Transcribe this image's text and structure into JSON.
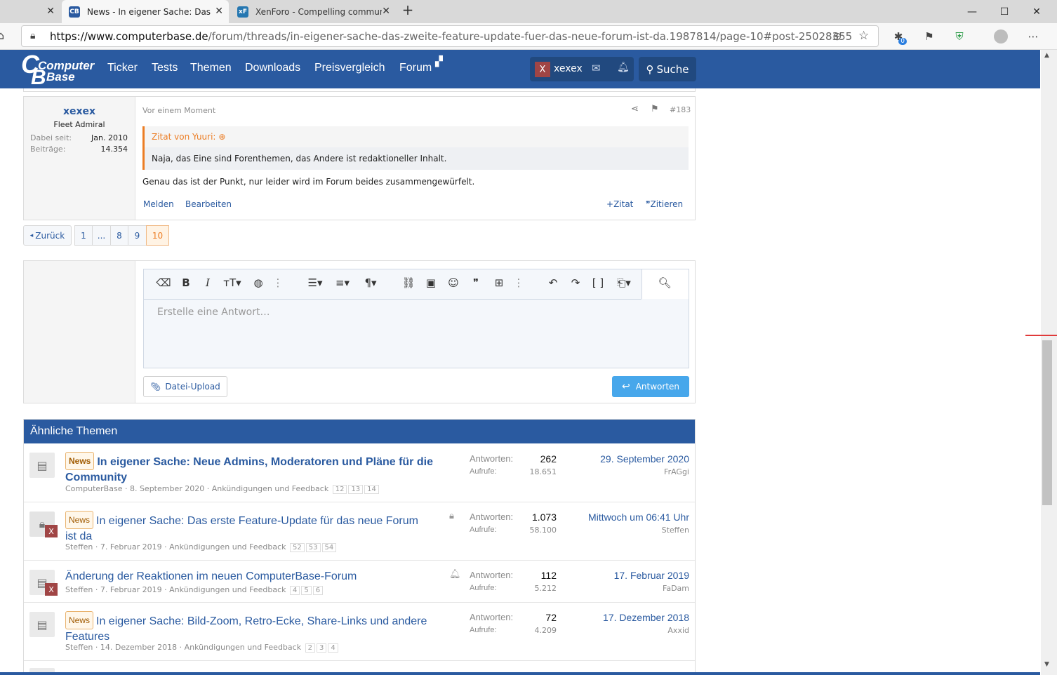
{
  "browser": {
    "tabs": [
      {
        "label": ""
      },
      {
        "label": "News - In eigener Sache: Das zw",
        "favicon": "CB"
      },
      {
        "label": "XenForo - Compelling communi",
        "favicon": "xF"
      }
    ],
    "url_domain": "https://www.computerbase.de",
    "url_path": "/forum/threads/in-eigener-sache-das-zweite-feature-update-fuer-das-neue-forum-ist-da.1987814/page-10#post-25028355",
    "extension_badge": "0"
  },
  "site": {
    "logo_line1": "Computer",
    "logo_line2": "Base",
    "nav": [
      "Ticker",
      "Tests",
      "Themen",
      "Downloads",
      "Preisvergleich",
      "Forum"
    ],
    "user_initial": "X",
    "username": "xexex",
    "search_label": "Suche"
  },
  "post": {
    "author": "xexex",
    "rank": "Fleet Admiral",
    "joined_label": "Dabei seit:",
    "joined_value": "Jan. 2010",
    "posts_label": "Beiträge:",
    "posts_value": "14.354",
    "time": "Vor einem Moment",
    "number": "#183",
    "quote_header": "Zitat von Yuuri:",
    "quote_text": "Naja, das Eine sind Forenthemen, das Andere ist redaktioneller Inhalt.",
    "body": "Genau das ist der Punkt, nur leider wird im Forum beides zusammengewürfelt.",
    "actions": {
      "report": "Melden",
      "edit": "Bearbeiten",
      "addquote": "Zitat",
      "quote": "Zitieren"
    }
  },
  "pagination": {
    "back": "Zurück",
    "pages": [
      "1",
      "...",
      "8",
      "9",
      "10"
    ],
    "current": "10"
  },
  "editor": {
    "placeholder": "Erstelle eine Antwort…",
    "upload": "Datei-Upload",
    "reply": "Antworten"
  },
  "similar": {
    "heading": "Ähnliche Themen",
    "stat_replies": "Antworten:",
    "stat_views": "Aufrufe:",
    "rows": [
      {
        "badge": "News",
        "title": "In eigener Sache: Neue Admins, Moderatoren und Pläne für die",
        "title2": "Community",
        "meta": "ComputerBase · 8. September 2020 · Ankündigungen und Feedback",
        "pages": [
          "12",
          "13",
          "14"
        ],
        "replies": "262",
        "views": "18.651",
        "last": "29. September 2020",
        "last_user": "FrAGgi"
      },
      {
        "badge": "News",
        "title": "In eigener Sache: Das erste Feature-Update für das neue Forum",
        "title2": "ist da",
        "meta": "Steffen · 7. Februar 2019 · Ankündigungen und Feedback",
        "pages": [
          "52",
          "53",
          "54"
        ],
        "replies": "1.073",
        "views": "58.100",
        "last": "Mittwoch um 06:41 Uhr",
        "last_user": "Steffen"
      },
      {
        "badge": "",
        "title": "Änderung der Reaktionen im neuen ComputerBase-Forum",
        "title2": "",
        "meta": "Steffen · 7. Februar 2019 · Ankündigungen und Feedback",
        "pages": [
          "4",
          "5",
          "6"
        ],
        "replies": "112",
        "views": "5.212",
        "last": "17. Februar 2019",
        "last_user": "FaDam"
      },
      {
        "badge": "News",
        "title": "In eigener Sache: Bild-Zoom, Retro-Ecke, Share-Links und andere",
        "title2": "Features",
        "meta": "Steffen · 14. Dezember 2018 · Ankündigungen und Feedback",
        "pages": [
          "2",
          "3",
          "4"
        ],
        "replies": "72",
        "views": "4.209",
        "last": "17. Dezember 2018",
        "last_user": "Axxid"
      }
    ]
  }
}
